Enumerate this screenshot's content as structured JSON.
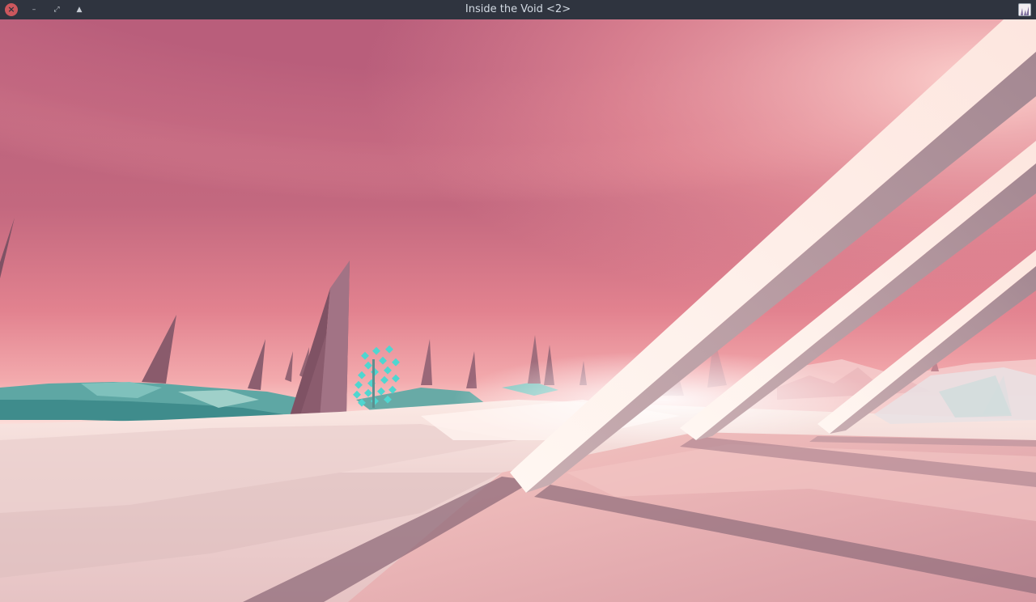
{
  "window": {
    "title": "Inside the Void <2>",
    "buttons": {
      "close_glyph": "×",
      "minimize_glyph": "–",
      "maximize_glyph": "⤢",
      "shade_glyph": "▲"
    },
    "app_icon": "game-app-icon"
  },
  "scene": {
    "palette": {
      "sky_top": "#b9607a",
      "sky_mid": "#e88a96",
      "sky_horizon": "#fbd9d9",
      "ground_light": "#f4dcd8",
      "ground_shadow": "#8f6b7a",
      "water_teal": "#4f9e9c",
      "spike_dark": "#8a5a6a",
      "beam_light": "#fbe8e2",
      "beam_shadow": "#b39aa2",
      "crystal_cyan": "#4fd6d0"
    }
  }
}
